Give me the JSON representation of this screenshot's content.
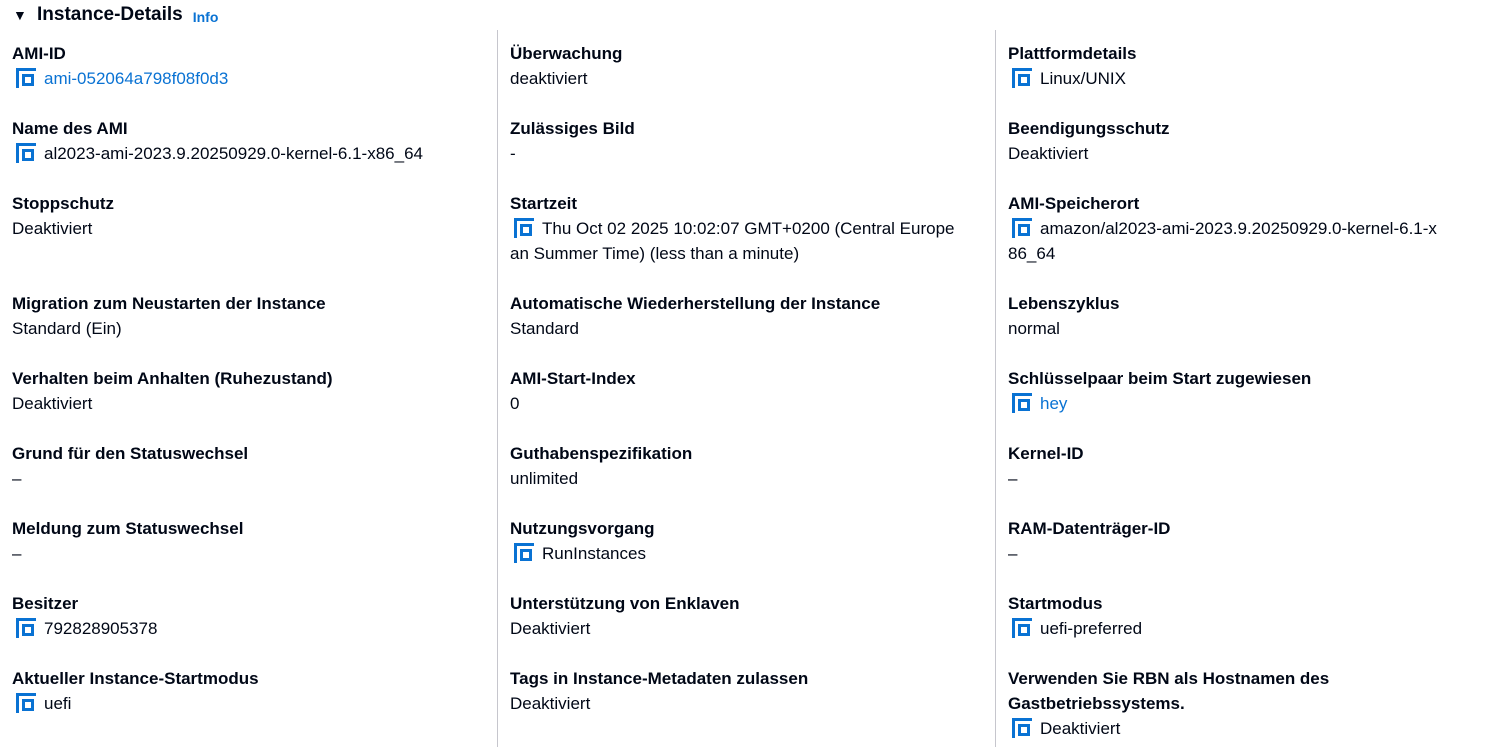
{
  "header": {
    "title": "Instance-Details",
    "info": "Info"
  },
  "col1": {
    "f1": {
      "label": "AMI-ID",
      "value": "ami-052064a798f08f0d3"
    },
    "f2": {
      "label": "Name des AMI",
      "value": "al2023-ami-2023.9.20250929.0-kernel-6.1-x86_64"
    },
    "f3": {
      "label": "Stoppschutz",
      "value": "Deaktiviert"
    },
    "f4": {
      "label": "Migration zum Neustarten der Instance",
      "value": "Standard (Ein)"
    },
    "f5": {
      "label": "Verhalten beim Anhalten (Ruhezustand)",
      "value": "Deaktiviert"
    },
    "f6": {
      "label": "Grund für den Statuswechsel",
      "value": "–"
    },
    "f7": {
      "label": "Meldung zum Statuswechsel",
      "value": "–"
    },
    "f8": {
      "label": "Besitzer",
      "value": "792828905378"
    },
    "f9": {
      "label": "Aktueller Instance-Startmodus",
      "value": "uefi"
    }
  },
  "col2": {
    "f1": {
      "label": "Überwachung",
      "value": "deaktiviert"
    },
    "f2": {
      "label": "Zulässiges Bild",
      "value": "-"
    },
    "f3": {
      "label": "Startzeit",
      "value_line1": "Thu Oct 02 2025 10:02:07 GMT+0200 (Central Europe",
      "value_line2": "an Summer Time) (less than a minute)"
    },
    "f4": {
      "label": "Automatische Wiederherstellung der Instance",
      "value": "Standard"
    },
    "f5": {
      "label": "AMI-Start-Index",
      "value": "0"
    },
    "f6": {
      "label": "Guthabenspezifikation",
      "value": "unlimited"
    },
    "f7": {
      "label": "Nutzungsvorgang",
      "value": "RunInstances"
    },
    "f8": {
      "label": "Unterstützung von Enklaven",
      "value": "Deaktiviert"
    },
    "f9": {
      "label": "Tags in Instance-Metadaten zulassen",
      "value": "Deaktiviert"
    }
  },
  "col3": {
    "f1": {
      "label": "Plattformdetails",
      "value": "Linux/UNIX"
    },
    "f2": {
      "label": "Beendigungsschutz",
      "value": "Deaktiviert"
    },
    "f3": {
      "label": "AMI-Speicherort",
      "value_line1": "amazon/al2023-ami-2023.9.20250929.0-kernel-6.1-x",
      "value_line2": "86_64"
    },
    "f4": {
      "label": "Lebenszyklus",
      "value": "normal"
    },
    "f5": {
      "label": "Schlüsselpaar beim Start zugewiesen",
      "value": "hey"
    },
    "f6": {
      "label": "Kernel-ID",
      "value": "–"
    },
    "f7": {
      "label": "RAM-Datenträger-ID",
      "value": "–"
    },
    "f8": {
      "label": "Startmodus",
      "value": "uefi-preferred"
    },
    "f9": {
      "label_line1": "Verwenden Sie RBN als Hostnamen des",
      "label_line2": "Gastbetriebssystems.",
      "value": "Deaktiviert"
    }
  },
  "colors": {
    "link": "#0972d3",
    "text": "#000716",
    "divider": "#c6c6cd"
  },
  "icons": {
    "copy": "copy-icon",
    "caret": "caret-down-icon"
  }
}
